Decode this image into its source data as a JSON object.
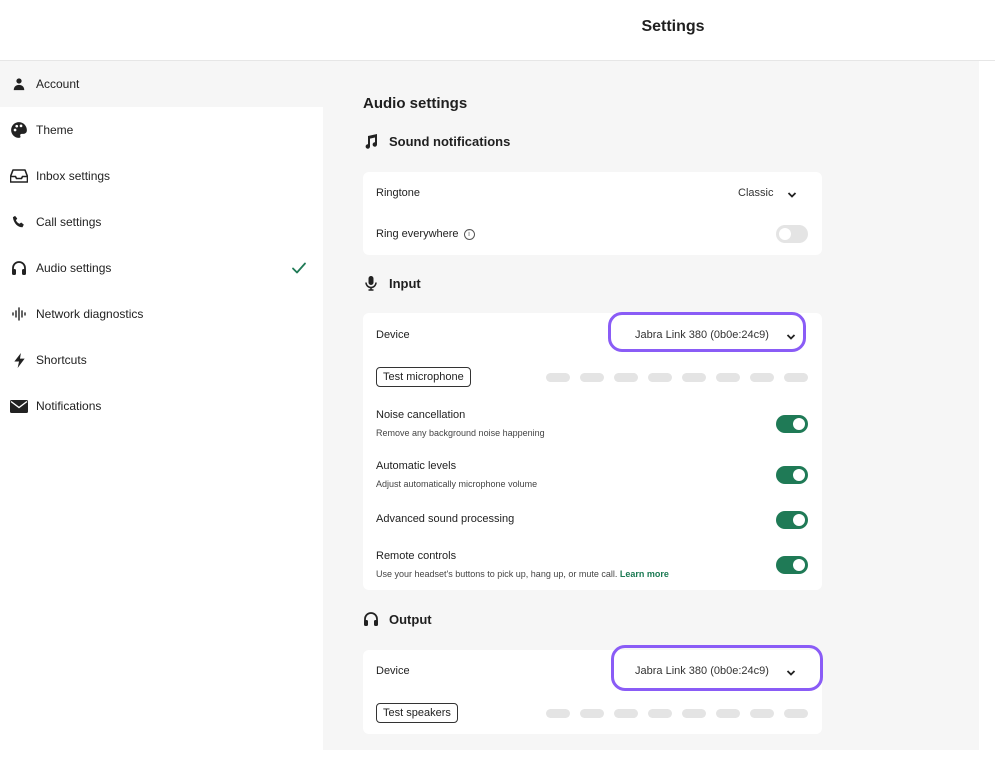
{
  "header": {
    "title": "Settings"
  },
  "sidebar": {
    "items": [
      {
        "label": "Account",
        "icon": "person-icon",
        "active": true
      },
      {
        "label": "Theme",
        "icon": "palette-icon"
      },
      {
        "label": "Inbox settings",
        "icon": "inbox-icon"
      },
      {
        "label": "Call settings",
        "icon": "phone-icon"
      },
      {
        "label": "Audio settings",
        "icon": "headphones-icon",
        "checked": true
      },
      {
        "label": "Network diagnostics",
        "icon": "waveform-icon"
      },
      {
        "label": "Shortcuts",
        "icon": "lightning-icon"
      },
      {
        "label": "Notifications",
        "icon": "envelope-icon"
      }
    ],
    "check_color": "#1f7a56"
  },
  "main": {
    "title": "Audio settings",
    "sound": {
      "heading": "Sound notifications",
      "ringtone_label": "Ringtone",
      "ringtone_value": "Classic",
      "ring_everywhere_label": "Ring everywhere",
      "ring_everywhere_on": false
    },
    "input": {
      "heading": "Input",
      "device_label": "Device",
      "device_value": "Jabra Link 380 (0b0e:24c9)",
      "test_button": "Test microphone",
      "noise_label": "Noise cancellation",
      "noise_sub": "Remove any background noise happening",
      "auto_label": "Automatic levels",
      "auto_sub": "Adjust automatically microphone volume",
      "advanced_label": "Advanced sound processing",
      "remote_label": "Remote controls",
      "remote_sub": "Use your headset's buttons to pick up, hang up, or mute call.",
      "remote_link": "Learn more"
    },
    "output": {
      "heading": "Output",
      "device_label": "Device",
      "device_value": "Jabra Link 380 (0b0e:24c9)",
      "test_button": "Test speakers"
    }
  },
  "colors": {
    "accent": "#1f7a56",
    "highlight": "#8a5cf6",
    "panel_bg": "#f6f6f6"
  }
}
